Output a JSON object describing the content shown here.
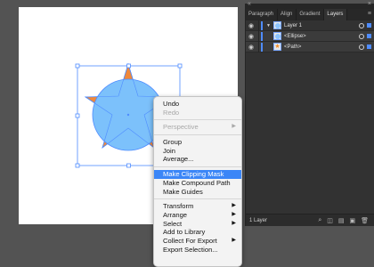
{
  "panel": {
    "tabs": [
      "Paragraph",
      "Align",
      "Gradient",
      "Layers"
    ],
    "layers": [
      {
        "name": "Layer 1"
      },
      {
        "name": "<Ellipse>"
      },
      {
        "name": "<Path>"
      }
    ],
    "footer_count": "1 Layer"
  },
  "context_menu": {
    "items": [
      {
        "label": "Undo",
        "disabled": false
      },
      {
        "label": "Redo",
        "disabled": true
      },
      {
        "label": "Perspective",
        "disabled": true,
        "submenu": true
      },
      {
        "label": "Group",
        "disabled": false
      },
      {
        "label": "Join",
        "disabled": false
      },
      {
        "label": "Average...",
        "disabled": false
      },
      {
        "label": "Make Clipping Mask",
        "disabled": false,
        "highlighted": true
      },
      {
        "label": "Make Compound Path",
        "disabled": false
      },
      {
        "label": "Make Guides",
        "disabled": false
      },
      {
        "label": "Transform",
        "disabled": false,
        "submenu": true
      },
      {
        "label": "Arrange",
        "disabled": false,
        "submenu": true
      },
      {
        "label": "Select",
        "disabled": false,
        "submenu": true
      },
      {
        "label": "Add to Library",
        "disabled": false
      },
      {
        "label": "Collect For Export",
        "disabled": false,
        "submenu": true
      },
      {
        "label": "Export Selection...",
        "disabled": false
      }
    ]
  },
  "colors": {
    "ellipse_fill": "#7cc1fb",
    "star_fill": "#f0883a",
    "selection": "#4f8cff",
    "menu_highlight": "#3b86f7"
  }
}
